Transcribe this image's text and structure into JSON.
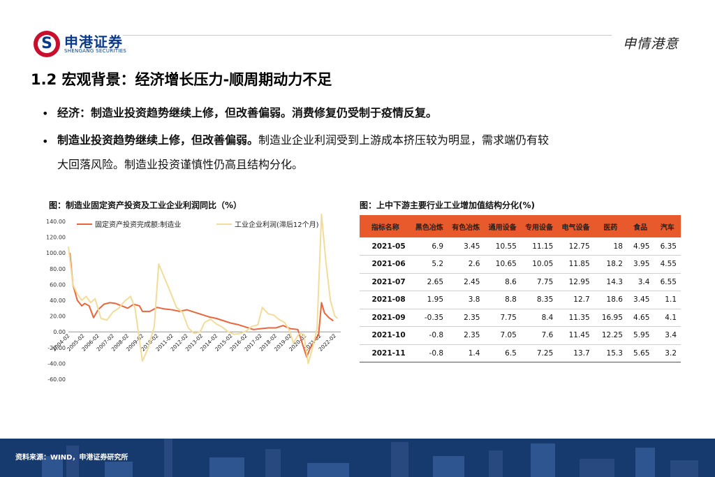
{
  "header": {
    "brand_cn": "申港证券",
    "brand_en": "SHENGANG SECURITIES",
    "slogan": "申情港意"
  },
  "title": "1.2  宏观背景：经济增长压力-顺周期动力不足",
  "bullets": [
    {
      "bold": "经济：制造业投资趋势继续上修，但改善偏弱。消费修复仍受制于疫情反复。",
      "rest": ""
    },
    {
      "bold": "制造业投资趋势继续上修，但改善偏弱。",
      "rest": "制造业企业利润受到上游成本挤压较为明显，需求端仍有较",
      "rest2": "大回落风险。制造业投资谨慎性仍高且结构分化。"
    }
  ],
  "left_figure_title": "图：制造业固定资产投资及工业企业利润同比（%）",
  "right_figure_title": "图：上中下游主要行业工业增加值结构分化(%)",
  "source": "资料来源：WIND，申港证券研究所",
  "colors": {
    "series1": "#e8663a",
    "series2": "#f2dc9a",
    "table_header": "#e85a2b",
    "footer": "#173a6e"
  },
  "chart_data": [
    {
      "type": "line",
      "title": "制造业固定资产投资及工业企业利润同比（%）",
      "ylim": [
        -60,
        140
      ],
      "yticks": [
        "140.00",
        "120.00",
        "100.00",
        "80.00",
        "60.00",
        "40.00",
        "20.00",
        "0.00",
        "-20.00",
        "-40.00",
        "-60.00"
      ],
      "xticks": [
        "2004-02",
        "2005-02",
        "2006-02",
        "2007-02",
        "2008-02",
        "2009-02",
        "2010-02",
        "2011-02",
        "2012-02",
        "2013-02",
        "2014-02",
        "2015-02",
        "2016-02",
        "2017-02",
        "2018-02",
        "2019-02",
        "2020-02",
        "2021-02",
        "2022-02"
      ],
      "legend_position": "top",
      "series": [
        {
          "name": "固定资产投资完成额:制造业",
          "points": [
            [
              2004.1,
              100
            ],
            [
              2004.3,
              60
            ],
            [
              2004.6,
              40
            ],
            [
              2004.9,
              33
            ],
            [
              2005.1,
              36
            ],
            [
              2005.4,
              33
            ],
            [
              2005.7,
              18
            ],
            [
              2006.0,
              28
            ],
            [
              2006.4,
              35
            ],
            [
              2006.8,
              37
            ],
            [
              2007.2,
              36
            ],
            [
              2007.6,
              33
            ],
            [
              2008.0,
              30
            ],
            [
              2008.4,
              35
            ],
            [
              2008.8,
              33
            ],
            [
              2009.0,
              26
            ],
            [
              2009.5,
              26
            ],
            [
              2010.0,
              31
            ],
            [
              2010.5,
              29
            ],
            [
              2011.0,
              28
            ],
            [
              2011.5,
              26
            ],
            [
              2012.0,
              28
            ],
            [
              2012.5,
              25
            ],
            [
              2013.0,
              22
            ],
            [
              2013.5,
              19
            ],
            [
              2014.0,
              17
            ],
            [
              2014.5,
              14
            ],
            [
              2015.0,
              11
            ],
            [
              2015.5,
              9
            ],
            [
              2016.0,
              6
            ],
            [
              2016.5,
              3
            ],
            [
              2017.0,
              4
            ],
            [
              2017.5,
              5
            ],
            [
              2018.0,
              5
            ],
            [
              2018.5,
              8
            ],
            [
              2019.0,
              4
            ],
            [
              2019.5,
              3
            ],
            [
              2020.1,
              -32
            ],
            [
              2020.3,
              -22
            ],
            [
              2020.6,
              -12
            ],
            [
              2020.9,
              -4
            ],
            [
              2021.1,
              37
            ],
            [
              2021.3,
              24
            ],
            [
              2021.6,
              18
            ],
            [
              2021.9,
              14
            ]
          ]
        },
        {
          "name": "工业企业利润(滞后12个月)",
          "points": [
            [
              2004.0,
              108
            ],
            [
              2004.3,
              60
            ],
            [
              2004.6,
              48
            ],
            [
              2004.9,
              40
            ],
            [
              2005.2,
              45
            ],
            [
              2005.5,
              37
            ],
            [
              2005.8,
              42
            ],
            [
              2006.2,
              17
            ],
            [
              2006.6,
              15
            ],
            [
              2007.0,
              25
            ],
            [
              2007.4,
              30
            ],
            [
              2007.8,
              39
            ],
            [
              2008.2,
              45
            ],
            [
              2008.5,
              30
            ],
            [
              2009.0,
              -37
            ],
            [
              2009.4,
              -20
            ],
            [
              2009.8,
              7
            ],
            [
              2010.1,
              86
            ],
            [
              2010.5,
              68
            ],
            [
              2010.9,
              50
            ],
            [
              2011.3,
              31
            ],
            [
              2011.7,
              25
            ],
            [
              2012.1,
              5
            ],
            [
              2012.5,
              -2
            ],
            [
              2012.9,
              0
            ],
            [
              2013.2,
              12
            ],
            [
              2013.6,
              16
            ],
            [
              2014.0,
              10
            ],
            [
              2014.4,
              6
            ],
            [
              2014.8,
              0
            ],
            [
              2015.2,
              -3
            ],
            [
              2015.6,
              -2
            ],
            [
              2016.0,
              1
            ],
            [
              2016.4,
              7
            ],
            [
              2016.8,
              9
            ],
            [
              2017.1,
              31
            ],
            [
              2017.5,
              23
            ],
            [
              2017.9,
              21
            ],
            [
              2018.2,
              16
            ],
            [
              2018.6,
              12
            ],
            [
              2018.9,
              3
            ],
            [
              2019.2,
              -14
            ],
            [
              2019.6,
              -2
            ],
            [
              2019.9,
              -3
            ],
            [
              2020.2,
              -40
            ],
            [
              2020.5,
              -20
            ],
            [
              2020.8,
              5
            ],
            [
              2021.1,
              180
            ],
            [
              2021.4,
              88
            ],
            [
              2021.7,
              40
            ],
            [
              2022.0,
              20
            ],
            [
              2022.2,
              17
            ]
          ]
        }
      ]
    },
    {
      "type": "table",
      "title": "上中下游主要行业工业增加值结构分化(%)",
      "columns": [
        "指标名称",
        "黑色冶炼",
        "有色冶炼",
        "通用设备",
        "专用设备",
        "电气设备",
        "医药",
        "食品",
        "汽车"
      ],
      "rows": [
        [
          "2021-05",
          "6.9",
          "3.45",
          "10.55",
          "11.15",
          "12.75",
          "18",
          "4.95",
          "6.35"
        ],
        [
          "2021-06",
          "5.2",
          "2.6",
          "10.65",
          "10.05",
          "11.85",
          "18.2",
          "3.95",
          "4.55"
        ],
        [
          "2021-07",
          "2.65",
          "2.45",
          "8.6",
          "7.75",
          "12.95",
          "14.3",
          "3.4",
          "6.55"
        ],
        [
          "2021-08",
          "1.95",
          "3.8",
          "8.8",
          "8.35",
          "12.7",
          "18.6",
          "3.45",
          "1.1"
        ],
        [
          "2021-09",
          "-0.35",
          "2.35",
          "7.75",
          "8.4",
          "11.35",
          "16.95",
          "4.65",
          "4.1"
        ],
        [
          "2021-10",
          "-0.8",
          "2.35",
          "7.05",
          "7.6",
          "11.45",
          "12.25",
          "5.95",
          "3.4"
        ],
        [
          "2021-11",
          "-0.8",
          "1.4",
          "6.5",
          "7.25",
          "13.7",
          "15.3",
          "5.65",
          "3.2"
        ]
      ]
    }
  ]
}
